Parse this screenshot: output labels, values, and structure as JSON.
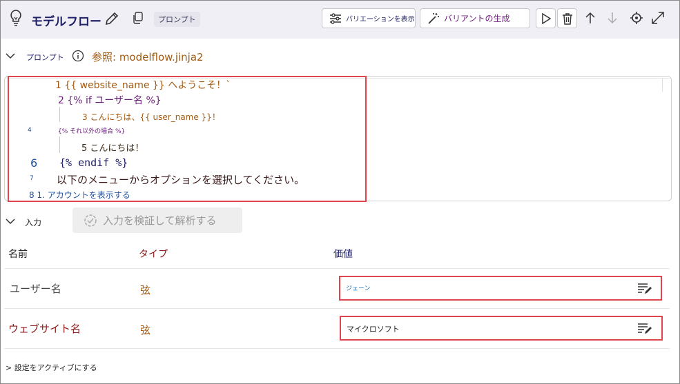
{
  "header": {
    "title": "モデルフロー",
    "badge": "プロンプト",
    "variations_button": "バリエーションを表示",
    "generate_button": "バリアントの生成"
  },
  "prompt": {
    "section_label": "プロンプト",
    "reference": "参照: modelflow.jinja2"
  },
  "editor": {
    "lines": [
      "1 {{ website_name }} へようこそ！`",
      "2 {% if ユーザー名 %}",
      "3 こんにちは、{{ user_name }}！",
      "4",
      "{% それ以外の場合 %}",
      "5 こんにちは！",
      "6",
      "{% endif %}",
      "7",
      "以下のメニューからオプションを選択してください。",
      "8 1. アカウントを表示する"
    ]
  },
  "inputs": {
    "section_label": "入力",
    "validate_button": "入力を検証して解析する",
    "columns": {
      "name": "名前",
      "type": "タイプ",
      "value": "価値"
    },
    "rows": [
      {
        "name": "ユーザー名",
        "type": "弦",
        "value": "ジェーン"
      },
      {
        "name": "ウェブサイト名",
        "type": "弦",
        "value": "マイクロソフト"
      }
    ]
  },
  "footer": {
    "activate_label": "> 設定をアクティブにする"
  },
  "colors": {
    "accent_red": "#e0444f",
    "navy": "#1f2166",
    "brown": "#a35a10",
    "purple": "#6b1f7a"
  }
}
